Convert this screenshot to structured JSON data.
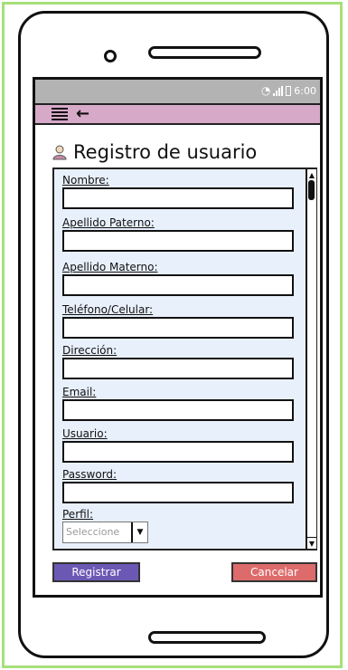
{
  "status_bar": {
    "time": "6:00"
  },
  "header": {
    "title": "Registro de usuario"
  },
  "form": {
    "fields": [
      {
        "label": "Nombre:",
        "value": ""
      },
      {
        "label": "Apellido Paterno:",
        "value": ""
      },
      {
        "label": "Apellido Materno:",
        "value": ""
      },
      {
        "label": "Teléfono/Celular:",
        "value": ""
      },
      {
        "label": "Dirección:",
        "value": ""
      },
      {
        "label": "Email:",
        "value": ""
      },
      {
        "label": "Usuario:",
        "value": ""
      },
      {
        "label": "Password:",
        "value": ""
      }
    ],
    "perfil": {
      "label": "Perfil:",
      "selected": "Seleccione"
    }
  },
  "actions": {
    "register_label": "Registrar",
    "cancel_label": "Cancelar"
  },
  "colors": {
    "frame_border": "#a6e07a",
    "appbar": "#d7a9c9",
    "form_panel": "#e8f0fc",
    "register_button": "#6b58b5",
    "cancel_button": "#dd6b6b",
    "statusbar": "#b3b3b3"
  },
  "icons": [
    "menu-icon",
    "back-arrow-icon",
    "user-icon",
    "wifi-icon",
    "signal-icon",
    "battery-icon",
    "scroll-up-icon",
    "scroll-down-icon",
    "chevron-down-icon"
  ]
}
